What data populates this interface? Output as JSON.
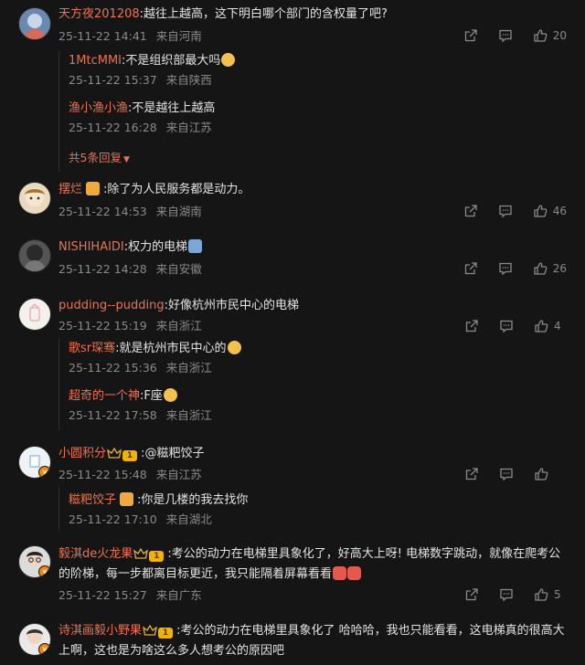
{
  "comments": [
    {
      "user": "天方夜201208",
      "text": ":越往上越高，这下明白哪个部门的含权量了吧?",
      "time": "25-11-22 14:41",
      "location": "来自河南",
      "likes": "20",
      "replies": [
        {
          "user": "1MtcMMI",
          "text": ":不是组织部最大吗",
          "time": "25-11-22 15:37",
          "location": "来自陕西"
        },
        {
          "user": "渔小渔小渔",
          "text": ":不是越往上越高",
          "time": "25-11-22 16:28",
          "location": "来自江苏"
        }
      ],
      "more_label": "共5条回复"
    },
    {
      "user": "摆烂",
      "text": ":除了为人民服务都是动力。",
      "time": "25-11-22 14:53",
      "location": "来自湖南",
      "likes": "46"
    },
    {
      "user": "NISHIHAIDI",
      "text": ":权力的电梯",
      "time": "25-11-22 14:28",
      "location": "来自安徽",
      "likes": "26"
    },
    {
      "user": "pudding--pudding",
      "text": ":好像杭州市民中心的电梯",
      "time": "25-11-22 15:19",
      "location": "来自浙江",
      "likes": "4",
      "replies": [
        {
          "user": "歌sr琛骞",
          "text": ":就是杭州市民中心的",
          "time": "25-11-22 15:36",
          "location": "来自浙江"
        },
        {
          "user": "超奇的一个神",
          "text": ":F座",
          "time": "25-11-22 17:58",
          "location": "来自浙江"
        }
      ]
    },
    {
      "user": "小圆积分",
      "text": ":@糍粑饺子",
      "time": "25-11-22 15:48",
      "location": "来自江苏",
      "likes": "",
      "replies": [
        {
          "user": "糍粑饺子",
          "text": ":你是几楼的我去找你",
          "time": "25-11-22 17:10",
          "location": "来自湖北"
        }
      ]
    },
    {
      "user": "毅淇de火龙果",
      "text": ":考公的动力在电梯里具象化了，好高大上呀! 电梯数字跳动，就像在爬考公的阶梯，每一步都离目标更近，我只能隔着屏幕看看",
      "time": "25-11-22 15:27",
      "location": "来自广东",
      "likes": "5"
    },
    {
      "user": "诗淇画毅小野果",
      "text": ":考公的动力在电梯里具象化了 哈哈哈，我也只能看看，这电梯真的很高大上啊，这也是为啥这么多人想考公的原因吧"
    }
  ],
  "level_badge": "1",
  "colors": {
    "username": "#eb7350",
    "meta": "#8a8a8a",
    "background": "#151515",
    "text": "#e4e4e4"
  },
  "icons": [
    "share-icon",
    "comment-icon",
    "like-icon",
    "chevron-down-icon",
    "crown-icon",
    "verified-icon"
  ]
}
